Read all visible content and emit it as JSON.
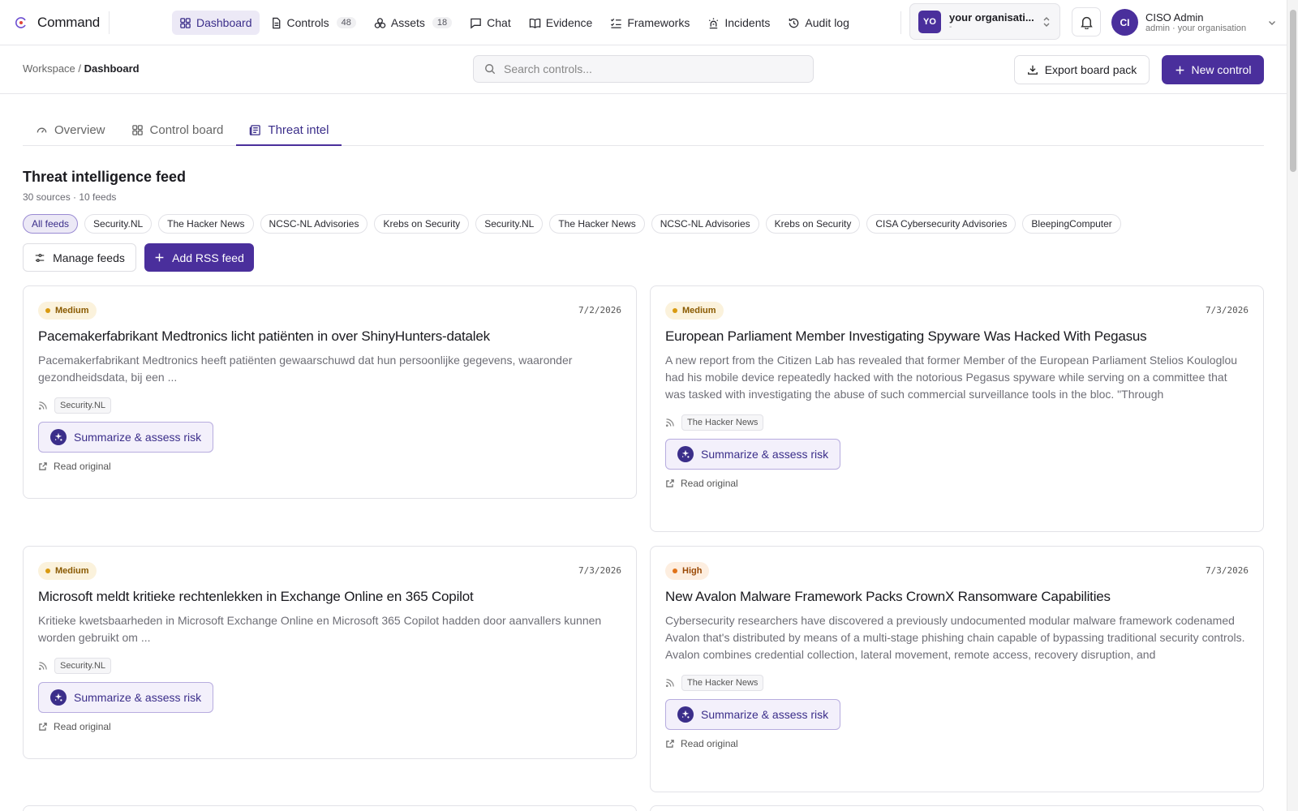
{
  "app": {
    "name": "Command"
  },
  "nav": [
    {
      "label": "Dashboard",
      "icon": "grid-icon",
      "active": true
    },
    {
      "label": "Controls",
      "icon": "document-icon",
      "count": "48"
    },
    {
      "label": "Assets",
      "icon": "boxes-icon",
      "count": "18"
    },
    {
      "label": "Chat",
      "icon": "chat-icon"
    },
    {
      "label": "Evidence",
      "icon": "book-icon"
    },
    {
      "label": "Frameworks",
      "icon": "list-check-icon"
    },
    {
      "label": "Incidents",
      "icon": "siren-icon"
    },
    {
      "label": "Audit log",
      "icon": "history-icon"
    }
  ],
  "org": {
    "badge": "YO",
    "name": "your organisati...",
    "sub": "-"
  },
  "user": {
    "initials": "CI",
    "name": "CISO Admin",
    "sub": "admin · your organisation"
  },
  "breadcrumb": {
    "root": "Workspace",
    "separator": "/",
    "current": "Dashboard"
  },
  "search": {
    "placeholder": "Search controls..."
  },
  "actions": {
    "export": "Export board pack",
    "new_control": "New control"
  },
  "tabs": [
    {
      "label": "Overview",
      "icon": "gauge-icon"
    },
    {
      "label": "Control board",
      "icon": "grid-icon"
    },
    {
      "label": "Threat intel",
      "icon": "newspaper-icon",
      "active": true
    }
  ],
  "feed": {
    "title": "Threat intelligence feed",
    "meta": "30 sources · 10 feeds",
    "chips": [
      "All feeds",
      "Security.NL",
      "The Hacker News",
      "NCSC-NL Advisories",
      "Krebs on Security",
      "Security.NL",
      "The Hacker News",
      "NCSC-NL Advisories",
      "Krebs on Security",
      "CISA Cybersecurity Advisories",
      "BleepingComputer"
    ],
    "manage": "Manage feeds",
    "add": "Add RSS feed"
  },
  "colors": {
    "accent": "#4a2f9c",
    "medium": "#d99a10",
    "high": "#e0731a"
  },
  "articles": [
    {
      "severity": "Medium",
      "date": "7/2/2026",
      "title": "Pacemakerfabrikant Medtronics licht patiënten in over ShinyHunters-datalek",
      "desc": "Pacemakerfabrikant Medtronics heeft patiënten gewaarschuwd dat hun persoonlijke gegevens, waaronder gezondheidsdata, bij een ...",
      "source": "Security.NL",
      "action": "Summarize & assess risk",
      "link": "Read original"
    },
    {
      "severity": "Medium",
      "date": "7/3/2026",
      "title": "European Parliament Member Investigating Spyware Was Hacked With Pegasus",
      "desc": "A new report from the Citizen Lab has revealed that former Member of the European Parliament Stelios Kouloglou had his mobile device repeatedly hacked with the notorious Pegasus spyware while serving on a committee that was tasked with investigating the abuse of such commercial surveillance tools in the bloc. \"Through",
      "source": "The Hacker News",
      "action": "Summarize & assess risk",
      "link": "Read original"
    },
    {
      "severity": "Medium",
      "date": "7/3/2026",
      "title": "Microsoft meldt kritieke rechtenlekken in Exchange Online en 365 Copilot",
      "desc": "Kritieke kwetsbaarheden in Microsoft Exchange Online en Microsoft 365 Copilot hadden door aanvallers kunnen worden gebruikt om ...",
      "source": "Security.NL",
      "action": "Summarize & assess risk",
      "link": "Read original"
    },
    {
      "severity": "High",
      "date": "7/3/2026",
      "title": "New Avalon Malware Framework Packs CrownX Ransomware Capabilities",
      "desc": "Cybersecurity researchers have discovered a previously undocumented modular malware framework codenamed Avalon that's distributed by means of a multi-stage phishing chain capable of bypassing traditional security controls. Avalon combines credential collection, lateral movement, remote access, recovery disruption, and",
      "source": "The Hacker News",
      "action": "Summarize & assess risk",
      "link": "Read original"
    }
  ]
}
